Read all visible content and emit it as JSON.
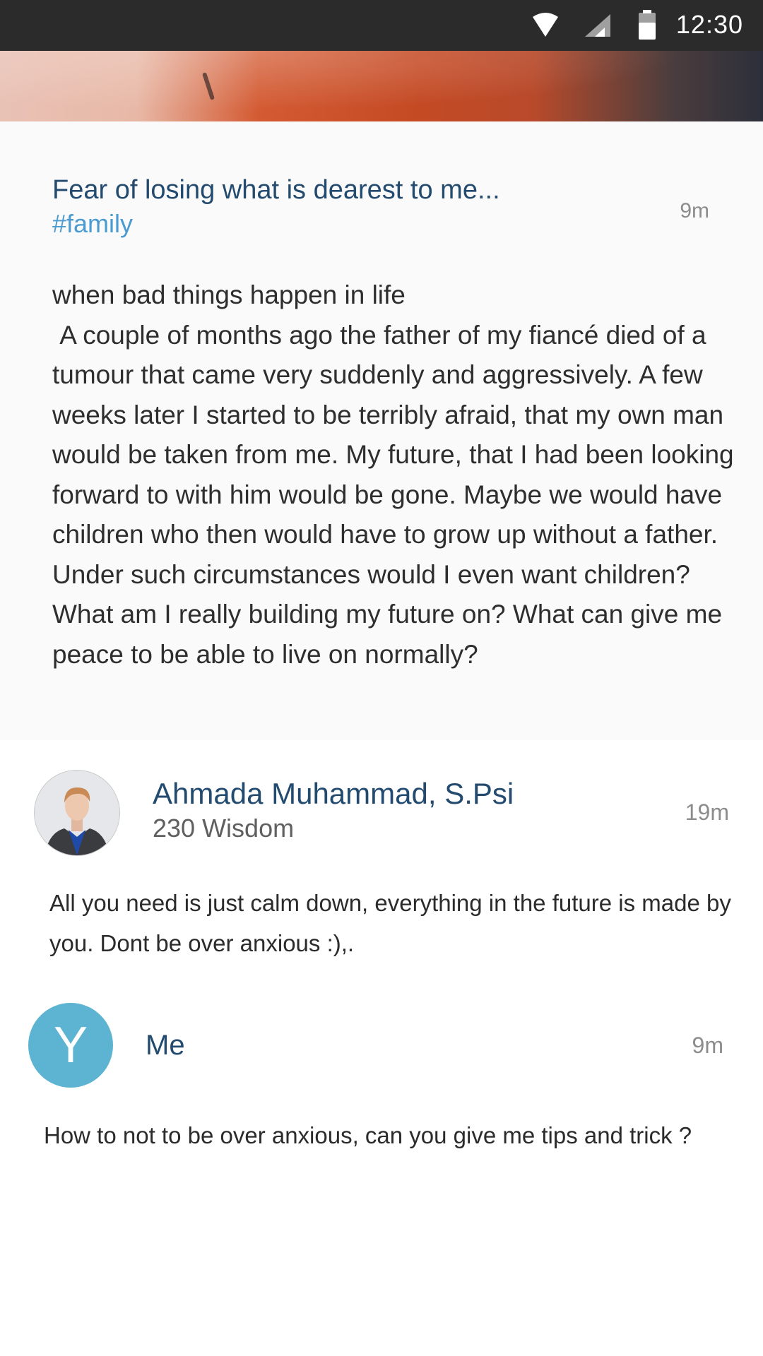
{
  "status_bar": {
    "time": "12:30",
    "icons": [
      "wifi-icon",
      "cell-signal-icon",
      "battery-icon"
    ]
  },
  "post": {
    "title": "Fear of losing what is dearest to me...",
    "tag": "#family",
    "time": "9m",
    "body": "when bad things happen in life\n A couple of months ago the father of my fiancé died of a tumour that came very suddenly and aggressively. A few weeks later I started to be terribly afraid, that my own man would be taken from me. My future, that I had been looking forward to with him would be gone. Maybe we would have children who then would have to grow up without a father. Under such circumstances would I even want children? What am I really building my future on? What can give me peace to be able to live on normally?"
  },
  "comment": {
    "author": "Ahmada Muhammad, S.Psi",
    "wisdom": "230 Wisdom",
    "time": "19m",
    "text": "All you need is just calm down, everything in the future is made by you. Dont be over anxious :),."
  },
  "reply": {
    "avatar_letter": "Y",
    "author": "Me",
    "time": "9m",
    "text": "How to not to be over anxious, can you give me tips and trick ?"
  },
  "colors": {
    "status_bar": "#2b2b2b",
    "title": "#234a6f",
    "tag": "#4b9bd1",
    "me_avatar": "#5cb4d2"
  }
}
